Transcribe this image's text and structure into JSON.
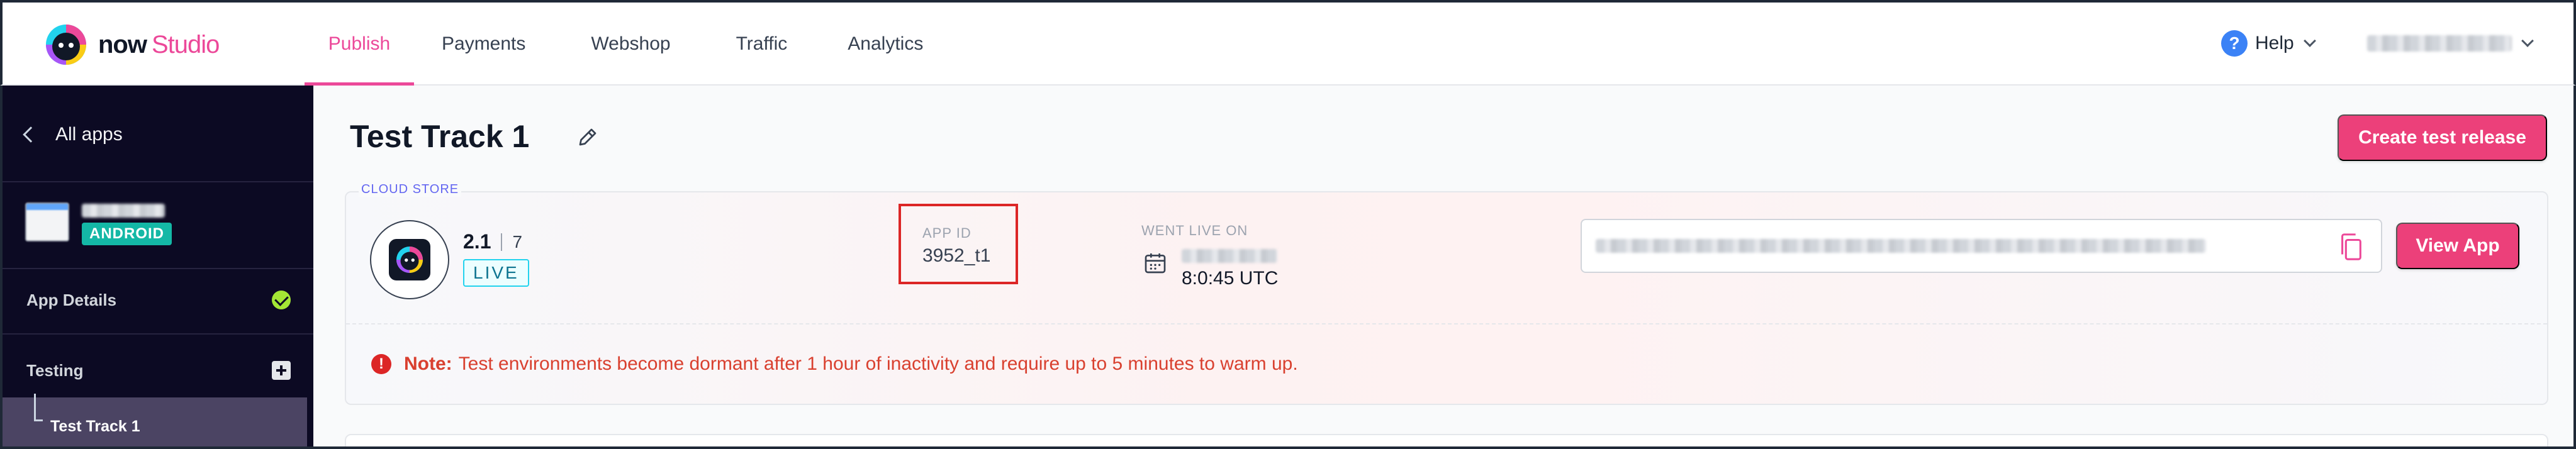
{
  "brand": {
    "now": "now",
    "studio": "Studio"
  },
  "nav": {
    "items": [
      {
        "label": "Publish",
        "active": true
      },
      {
        "label": "Payments",
        "active": false
      },
      {
        "label": "Webshop",
        "active": false
      },
      {
        "label": "Traffic",
        "active": false
      },
      {
        "label": "Analytics",
        "active": false
      }
    ],
    "help_label": "Help"
  },
  "sidebar": {
    "back_label": "All apps",
    "platform_badge": "ANDROID",
    "app_details_label": "App Details",
    "testing_label": "Testing",
    "active_track_label": "Test Track 1"
  },
  "main": {
    "title": "Test Track 1",
    "create_button": "Create test release"
  },
  "release_card": {
    "section_label": "CLOUD STORE",
    "version": "2.1",
    "build": "7",
    "status": "LIVE",
    "app_id_label": "APP ID",
    "app_id_value": "3952_t1",
    "went_live_label": "WENT LIVE ON",
    "went_live_time": "8:0:45 UTC",
    "view_app_button": "View App",
    "note_label": "Note:",
    "note_text": "Test environments become dormant after 1 hour of inactivity and require up to 5 minutes to warm up."
  },
  "colors": {
    "accent": "#ec4899",
    "sidebar_bg": "#0c0a23",
    "android_badge": "#14b8a6",
    "live_badge_border": "#22d3ee",
    "note_text": "#d9402f",
    "highlight_box": "#dc2626"
  },
  "icons": [
    "logo-icon",
    "help-icon",
    "chevron-down-icon",
    "chevron-left-icon",
    "check-icon",
    "plus-icon",
    "edit-icon",
    "calendar-icon",
    "copy-icon",
    "alert-icon"
  ]
}
